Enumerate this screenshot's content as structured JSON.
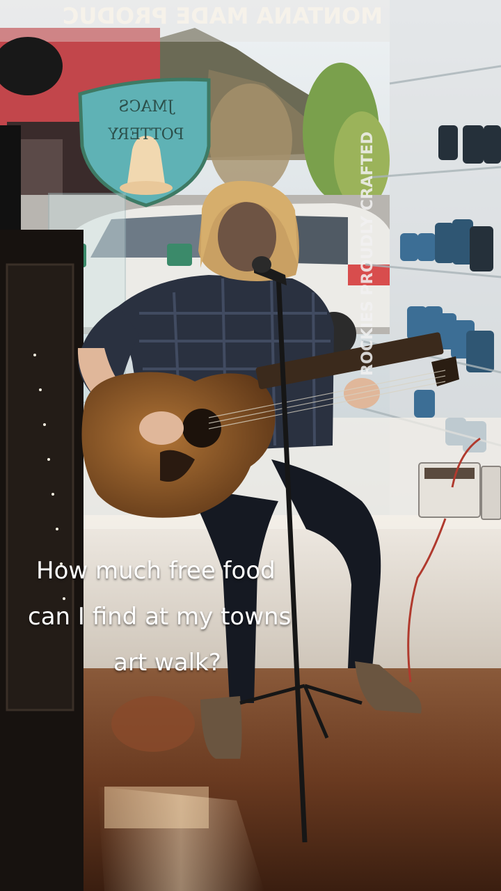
{
  "video": {
    "caption_lines": [
      "How much free food",
      "can I find at my towns",
      "art walk?"
    ],
    "window_lettering": "MONTANA MADE PRODUC",
    "sign_lettering": [
      "JMACS",
      "POTTERY"
    ],
    "shelf_lettering": "ROCKIES PROUDLY CRAFTED"
  },
  "colors": {
    "sky": "#dfe6ea",
    "floor": "#6b3b22",
    "sign_teal": "#5fb2b5",
    "mug_blue": "#3c6e95",
    "car_white": "#e8e6e2"
  }
}
